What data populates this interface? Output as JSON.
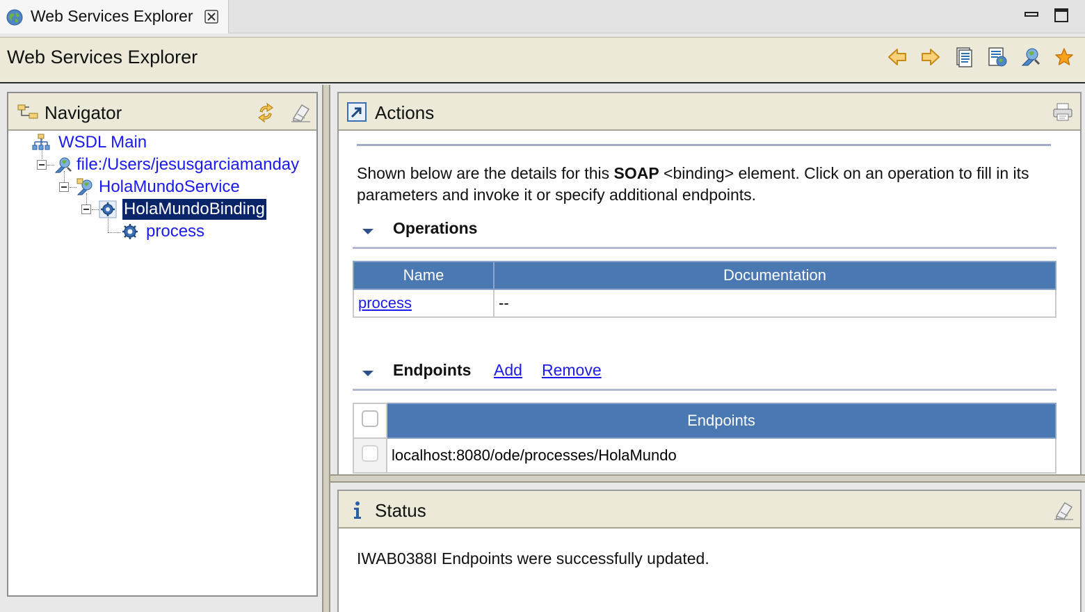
{
  "tab": {
    "title": "Web Services Explorer",
    "icon": "globe-icon",
    "close_icon": "close-icon"
  },
  "window_controls": {
    "minimize_icon": "minimize-icon",
    "maximize_icon": "maximize-icon"
  },
  "titlebar": {
    "title": "Web Services Explorer",
    "toolbar": [
      {
        "icon": "back-arrow-icon"
      },
      {
        "icon": "forward-arrow-icon"
      },
      {
        "icon": "uddi-page-icon"
      },
      {
        "icon": "wsil-page-icon"
      },
      {
        "icon": "wsdl-page-icon"
      },
      {
        "icon": "favorites-star-icon"
      }
    ]
  },
  "navigator": {
    "title": "Navigator",
    "icons": {
      "header": "navigator-icon",
      "refresh": "refresh-icon",
      "clear": "eraser-icon"
    },
    "tree": [
      {
        "label": "WSDL Main",
        "icon": "wsdl-main-icon",
        "level": 0
      },
      {
        "label": "file:/Users/jesusgarciamanday",
        "icon": "wsdl-file-icon",
        "level": 1
      },
      {
        "label": "HolaMundoService",
        "icon": "service-icon",
        "level": 2
      },
      {
        "label": "HolaMundoBinding",
        "icon": "binding-icon",
        "level": 3,
        "selected": true
      },
      {
        "label": "process",
        "icon": "operation-icon",
        "level": 4
      }
    ]
  },
  "actions": {
    "title": "Actions",
    "header_icon": "actions-icon",
    "print_icon": "print-icon",
    "description_pre": "Shown below are the details for this ",
    "description_bold": "SOAP",
    "description_post": " <binding> element. Click on an operation to fill in its parameters and invoke it or specify additional endpoints.",
    "operations": {
      "title": "Operations",
      "columns": [
        "Name",
        "Documentation"
      ],
      "rows": [
        {
          "name": "process",
          "documentation": "--"
        }
      ]
    },
    "endpoints": {
      "title": "Endpoints",
      "add_label": "Add",
      "remove_label": "Remove",
      "column": "Endpoints",
      "rows": [
        {
          "url": "localhost:8080/ode/processes/HolaMundo",
          "checked": false
        }
      ]
    }
  },
  "status": {
    "title": "Status",
    "header_icon": "info-icon",
    "clear_icon": "eraser-icon",
    "message": "IWAB0388I Endpoints were successfully updated."
  },
  "colors": {
    "selection": "#0a246a",
    "link": "#1a1af0",
    "table_header": "#4a78b3",
    "panel_header": "#ece9d8"
  }
}
